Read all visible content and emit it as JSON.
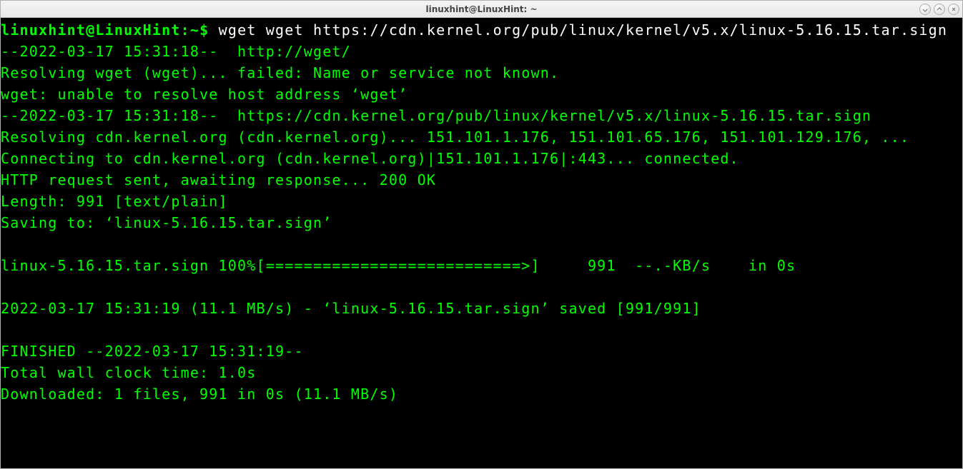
{
  "window": {
    "title": "linuxhint@LinuxHint: ~"
  },
  "prompt": {
    "user_host": "linuxhint@LinuxHint",
    "sep": ":",
    "path": "~",
    "symbol": "$"
  },
  "command": "wget wget https://cdn.kernel.org/pub/linux/kernel/v5.x/linux-5.16.15.tar.sign",
  "output_lines": [
    "--2022-03-17 15:31:18--  http://wget/",
    "Resolving wget (wget)... failed: Name or service not known.",
    "wget: unable to resolve host address ‘wget’",
    "--2022-03-17 15:31:18--  https://cdn.kernel.org/pub/linux/kernel/v5.x/linux-5.16.15.tar.sign",
    "Resolving cdn.kernel.org (cdn.kernel.org)... 151.101.1.176, 151.101.65.176, 151.101.129.176, ...",
    "Connecting to cdn.kernel.org (cdn.kernel.org)|151.101.1.176|:443... connected.",
    "HTTP request sent, awaiting response... 200 OK",
    "Length: 991 [text/plain]",
    "Saving to: ‘linux-5.16.15.tar.sign’",
    "",
    "linux-5.16.15.tar.sign 100%[===========================>]     991  --.-KB/s    in 0s",
    "",
    "2022-03-17 15:31:19 (11.1 MB/s) - ‘linux-5.16.15.tar.sign’ saved [991/991]",
    "",
    "FINISHED --2022-03-17 15:31:19--",
    "Total wall clock time: 1.0s",
    "Downloaded: 1 files, 991 in 0s (11.1 MB/s)"
  ]
}
